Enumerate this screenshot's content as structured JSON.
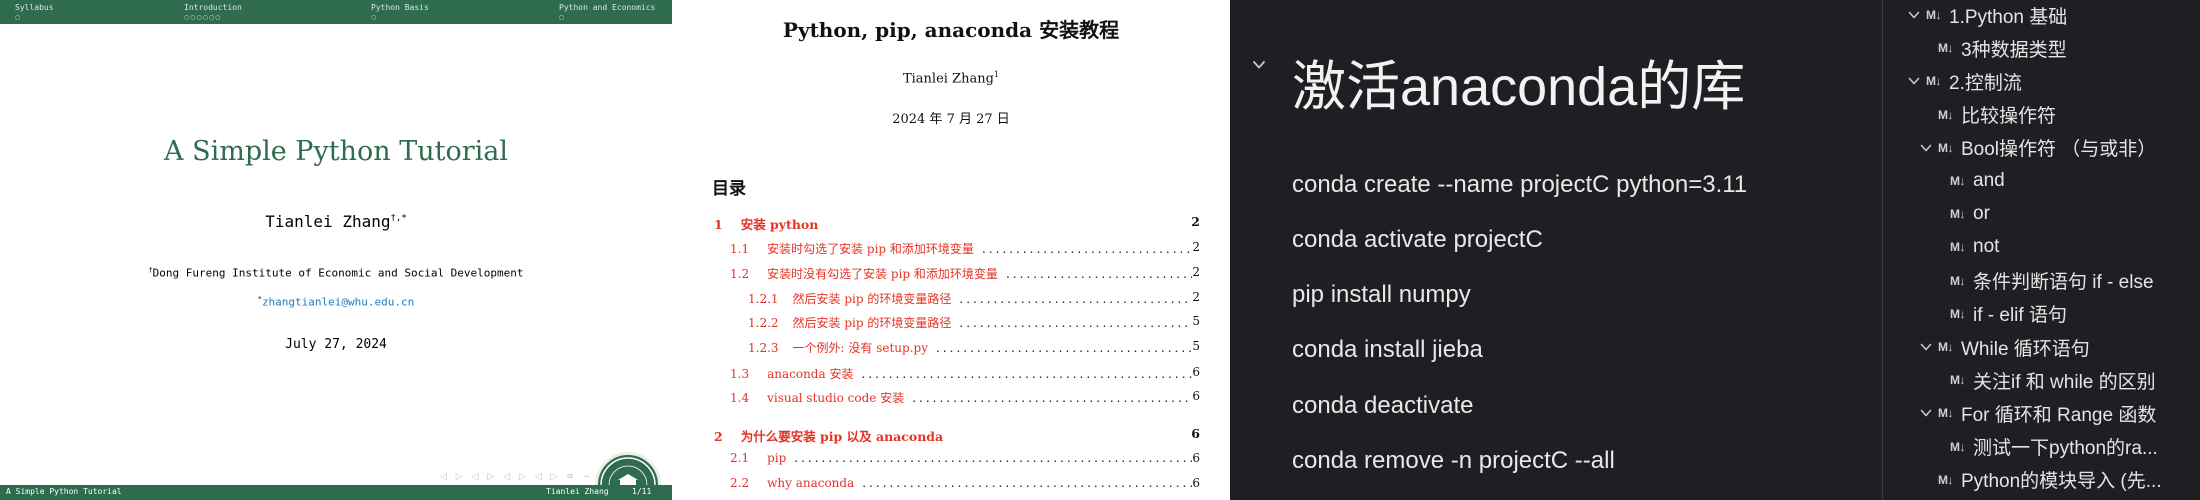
{
  "slide": {
    "nav_sections": [
      "Syllabus",
      "Introduction",
      "Python Basis",
      "Python and Economics"
    ],
    "nav_dots": [
      "○",
      "○○○○○○",
      "○",
      "○"
    ],
    "title": "A Simple Python Tutorial",
    "author": "Tianlei Zhang",
    "author_marks": "†,*",
    "affiliation_mark": "†",
    "affiliation": "Dong Fureng Institute of Economic and Social Development",
    "email_mark": "*",
    "email": "zhangtianlei@whu.edu.cn",
    "date": "July 27, 2024",
    "nav_controls": "◁ ▷ ◁ ▷ ◁ ▷ ◁ ▷ ≡ ∽",
    "footer_left": "A Simple Python Tutorial",
    "footer_author": "Tianlei Zhang",
    "footer_page": "1/11",
    "colors": {
      "theme": "#2e6b4f",
      "link": "#1a7ec4"
    }
  },
  "pdf": {
    "title": "Python, pip, anaconda 安装教程",
    "author": "Tianlei Zhang",
    "author_mark": "1",
    "date": "2024 年 7 月 27 日",
    "toc_heading": "目录",
    "toc": [
      {
        "num": "1",
        "text": "安装 python",
        "page": "2",
        "level": 1
      },
      {
        "num": "1.1",
        "text": "安装时勾选了安装 pip 和添加环境变量",
        "page": "2",
        "level": 2
      },
      {
        "num": "1.2",
        "text": "安装时没有勾选了安装 pip 和添加环境变量",
        "page": "2",
        "level": 2
      },
      {
        "num": "1.2.1",
        "text": "然后安装 pip 的环境变量路径",
        "page": "2",
        "level": 3
      },
      {
        "num": "1.2.2",
        "text": "然后安装 pip 的环境变量路径",
        "page": "5",
        "level": 3
      },
      {
        "num": "1.2.3",
        "text": "一个例外: 没有 setup.py",
        "page": "5",
        "level": 3
      },
      {
        "num": "1.3",
        "text": "anaconda 安装",
        "page": "6",
        "level": 2
      },
      {
        "num": "1.4",
        "text": "visual studio code 安装",
        "page": "6",
        "level": 2
      },
      {
        "num": "2",
        "text": "为什么要安装 pip 以及 anaconda",
        "page": "6",
        "level": 1
      },
      {
        "num": "2.1",
        "text": "pip",
        "page": "6",
        "level": 2
      },
      {
        "num": "2.2",
        "text": "why anaconda",
        "page": "6",
        "level": 2
      }
    ],
    "colors": {
      "link": "#e53325"
    }
  },
  "note": {
    "heading": "激活anaconda的库",
    "commands": [
      "conda create --name projectC python=3.11",
      "conda activate projectC",
      "pip install numpy",
      "conda install jieba",
      "conda deactivate",
      "conda remove -n projectC --all"
    ],
    "colors": {
      "background": "#1e1f22",
      "text": "#e8e8e8"
    }
  },
  "outline": {
    "md_badge": "M↓",
    "items": [
      {
        "label": "1.Python 基础",
        "depth": 0,
        "toggle": "expanded"
      },
      {
        "label": "3种数据类型",
        "depth": 1,
        "toggle": "none"
      },
      {
        "label": "2.控制流",
        "depth": 0,
        "toggle": "expanded"
      },
      {
        "label": "比较操作符",
        "depth": 1,
        "toggle": "none"
      },
      {
        "label": "Bool操作符 （与或非）",
        "depth": 1,
        "toggle": "expanded"
      },
      {
        "label": "and",
        "depth": 2,
        "toggle": "none"
      },
      {
        "label": "or",
        "depth": 2,
        "toggle": "none"
      },
      {
        "label": "not",
        "depth": 2,
        "toggle": "none"
      },
      {
        "label": "条件判断语句 if - else",
        "depth": 2,
        "toggle": "none"
      },
      {
        "label": "if - elif 语句",
        "depth": 2,
        "toggle": "none"
      },
      {
        "label": "While 循环语句",
        "depth": 1,
        "toggle": "expanded"
      },
      {
        "label": "关注if 和 while 的区别",
        "depth": 2,
        "toggle": "none"
      },
      {
        "label": "For 循环和 Range 函数",
        "depth": 1,
        "toggle": "expanded"
      },
      {
        "label": "测试一下python的ra...",
        "depth": 2,
        "toggle": "none"
      },
      {
        "label": "Python的模块导入 (先...",
        "depth": 1,
        "toggle": "none"
      }
    ]
  }
}
